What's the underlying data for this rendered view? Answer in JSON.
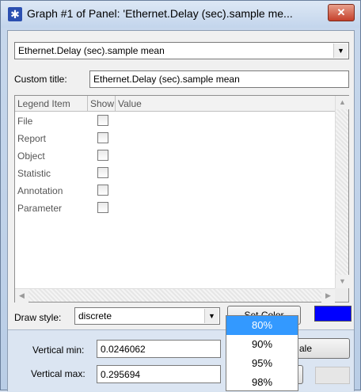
{
  "window": {
    "title": "Graph #1 of Panel: 'Ethernet.Delay (sec).sample me...",
    "close_label": "✕"
  },
  "series_select": {
    "value": "Ethernet.Delay (sec).sample mean"
  },
  "custom_title": {
    "label": "Custom title:",
    "value": "Ethernet.Delay (sec).sample mean"
  },
  "legend_table": {
    "columns": [
      "Legend Item",
      "Show",
      "Value"
    ],
    "rows": [
      {
        "label": "File",
        "show": false
      },
      {
        "label": "Report",
        "show": false
      },
      {
        "label": "Object",
        "show": false
      },
      {
        "label": "Statistic",
        "show": false
      },
      {
        "label": "Annotation",
        "show": false
      },
      {
        "label": "Parameter",
        "show": false
      }
    ]
  },
  "draw_style": {
    "label": "Draw style:",
    "value": "discrete"
  },
  "set_color_label": "Set Color",
  "series_color": "#0000ff",
  "vertical_min": {
    "label": "Vertical min:",
    "value": "0.0246062"
  },
  "vertical_max": {
    "label": "Vertical max:",
    "value": "0.295694"
  },
  "scale_button_label": "ale",
  "popup_options": [
    "80%",
    "90%",
    "95%",
    "98%"
  ],
  "popup_selected": "80%"
}
